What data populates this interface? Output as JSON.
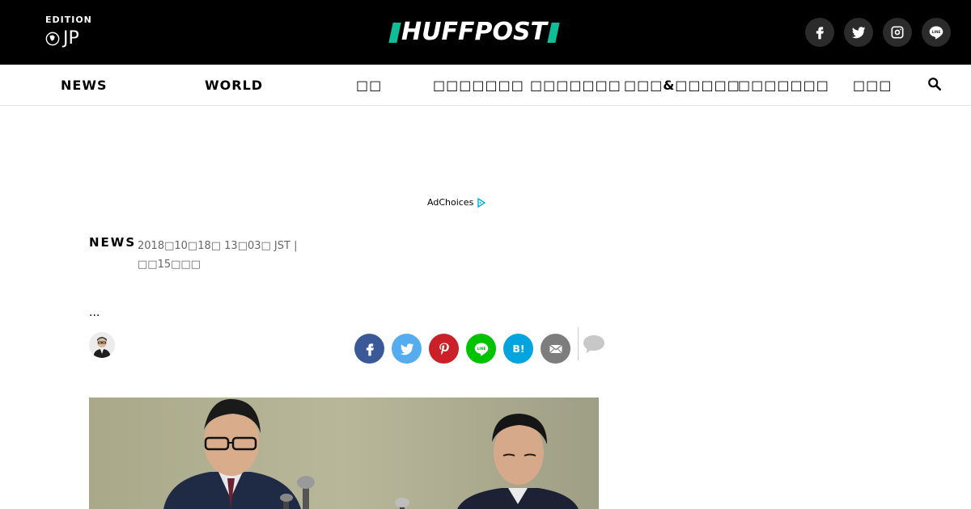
{
  "header": {
    "edition_label": "EDITION",
    "edition_code": "JP",
    "logo_text": "HUFFPOST",
    "colors": {
      "background": "#000000",
      "logo_accent": "#0dbe98"
    },
    "social": [
      {
        "icon": "facebook-icon"
      },
      {
        "icon": "twitter-icon"
      },
      {
        "icon": "instagram-icon"
      },
      {
        "icon": "line-icon"
      }
    ]
  },
  "nav": {
    "items": [
      {
        "label": "NEWS"
      },
      {
        "label": "WORLD"
      },
      {
        "label": "□□"
      },
      {
        "label": "□□□□□□□"
      },
      {
        "label": "□□□□□□□"
      },
      {
        "label": "□□□&□□□□□"
      },
      {
        "label": "□□□□□□□"
      },
      {
        "label": "□□□"
      }
    ],
    "search_icon": "search-icon"
  },
  "ad": {
    "adchoices_label": "AdChoices"
  },
  "article": {
    "section": "NEWS",
    "timestamp_line1": "2018□10□18□ 13□03□ JST |",
    "timestamp_line2": "□□15□□□",
    "dek": "...",
    "share": [
      {
        "icon": "facebook-icon",
        "color": "#3b5998"
      },
      {
        "icon": "twitter-icon",
        "color": "#55acee"
      },
      {
        "icon": "pinterest-icon",
        "color": "#cb2027"
      },
      {
        "icon": "line-icon",
        "color": "#00c300"
      },
      {
        "icon": "hatena-bookmark-icon",
        "color": "#00a4de"
      },
      {
        "icon": "email-icon",
        "color": "#7d7d7d"
      }
    ],
    "comment_icon": "comment-icon"
  }
}
